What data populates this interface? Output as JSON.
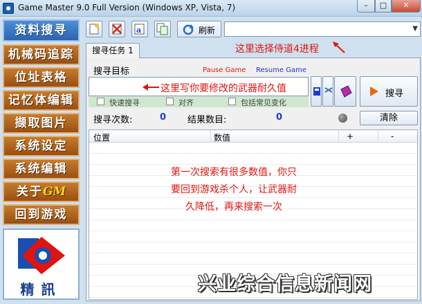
{
  "window": {
    "title": "Game Master 9.0 Full Version (Windows XP, Vista, 7)",
    "min_glyph": "–",
    "max_glyph": "□",
    "close_glyph": "✕"
  },
  "sidebar": {
    "top": "资料搜寻",
    "items": [
      {
        "label": "机械码追踪"
      },
      {
        "label": "位址表格"
      },
      {
        "label": "记忆体编辑"
      },
      {
        "label": "撷取图片"
      },
      {
        "label": "系统设定"
      },
      {
        "label": "系统编辑"
      },
      {
        "label": "关于",
        "accent": "GM"
      },
      {
        "label": "回到游戏"
      }
    ],
    "logo_text": "精訊"
  },
  "toolbar": {
    "refresh_label": "刷新",
    "process_value": ""
  },
  "tabs": [
    {
      "label": "搜寻任务 1"
    }
  ],
  "search": {
    "target_label": "搜寻目标",
    "pause_label": "Pause Game",
    "resume_label": "Resume Game",
    "value": "",
    "options": [
      {
        "label": "快速搜寻"
      },
      {
        "label": "对齐"
      },
      {
        "label": "包括常见变化"
      }
    ],
    "search_button": "搜寻",
    "count_label": "搜寻次数:",
    "count_value": "0",
    "results_label": "结果数目:",
    "results_value": "0",
    "clear_button": "清除"
  },
  "results": {
    "columns": [
      "位置",
      "数值",
      "+",
      "-"
    ],
    "rows": []
  },
  "annotations": {
    "process_hint": "这里选择侍道4进程",
    "input_hint": "这里写你要修改的武器耐久值",
    "instructions": [
      "第一次搜索有很多数值，你只",
      "要回到游戏杀个人，让武器耐",
      "久降低，再来搜索一次"
    ]
  },
  "watermark": "兴业综合信息新闻网",
  "colors": {
    "annotation": "#e0140d",
    "count": "#1a3fcf",
    "sidebar_button": "#b06420",
    "sidebar_top": "#3a77c4"
  }
}
